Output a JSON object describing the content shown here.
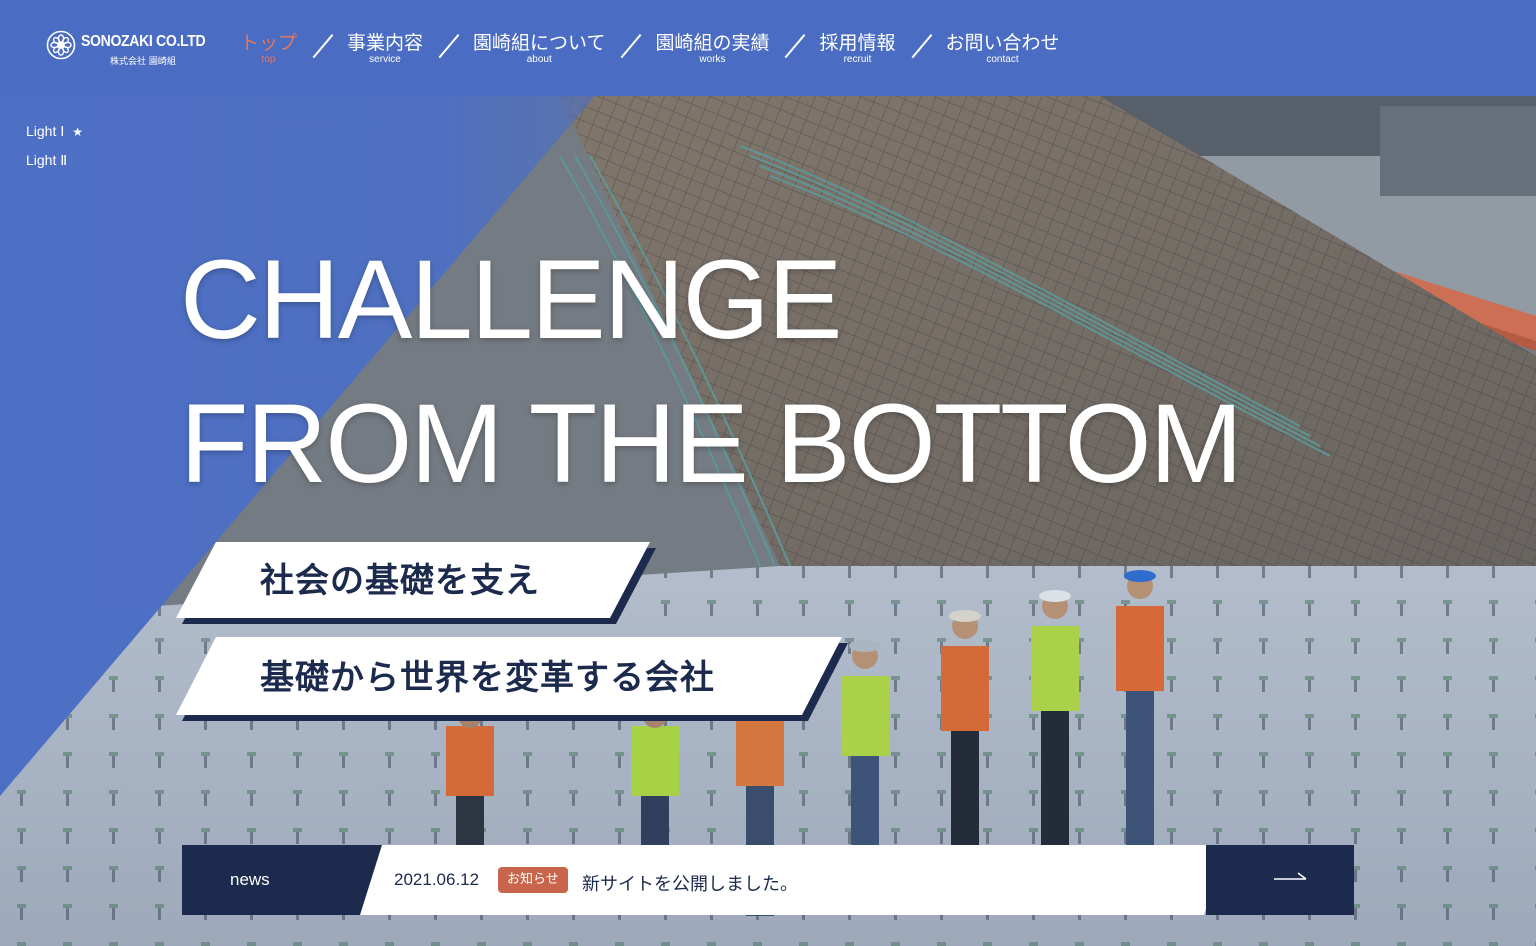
{
  "header": {
    "logo": {
      "name": "SONOZAKI CO.LTD",
      "sub": "株式会社 園崎組",
      "icon": "flower-emblem-icon"
    },
    "nav": [
      {
        "jp": "トップ",
        "en": "top",
        "active": true
      },
      {
        "jp": "事業内容",
        "en": "service",
        "active": false
      },
      {
        "jp": "園崎組について",
        "en": "about",
        "active": false
      },
      {
        "jp": "園崎組の実績",
        "en": "works",
        "active": false
      },
      {
        "jp": "採用情報",
        "en": "recruit",
        "active": false
      },
      {
        "jp": "お問い合わせ",
        "en": "contact",
        "active": false
      }
    ],
    "colors": {
      "background": "#4a6cc2",
      "active": "#e2775f",
      "text": "#ffffff"
    }
  },
  "hero": {
    "slider": [
      {
        "label": "Light Ⅰ",
        "current": true,
        "marker": "★"
      },
      {
        "label": "Light Ⅱ",
        "current": false
      }
    ],
    "headline": [
      "CHALLENGE",
      "FROM THE BOTTOM"
    ],
    "taglines": [
      "社会の基礎を支え",
      "基礎から世界を変革する会社"
    ],
    "image": "aerial-construction-site-workers",
    "colors": {
      "overlay": "#4d6fc4",
      "navy": "#1c2a4d"
    }
  },
  "news": {
    "label": "news",
    "date": "2021.06.12",
    "badge": "お知らせ",
    "title": "新サイトを公開しました。",
    "arrow_icon": "arrow-right-icon",
    "colors": {
      "badge": "#c9654a"
    }
  }
}
